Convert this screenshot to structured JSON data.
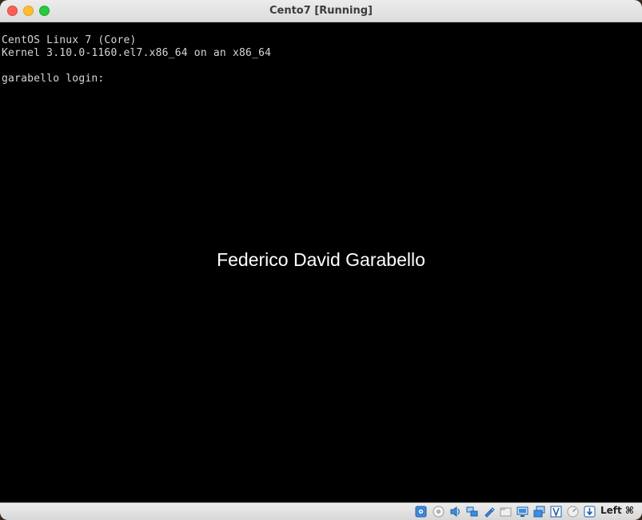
{
  "window": {
    "title": "Cento7 [Running]"
  },
  "console": {
    "lines": [
      "CentOS Linux 7 (Core)",
      "Kernel 3.10.0-1160.el7.x86_64 on an x86_64",
      "",
      "garabello login:"
    ]
  },
  "watermark": {
    "text": "Federico David Garabello"
  },
  "statusbar": {
    "icons": [
      "hard-disk-icon",
      "optical-drive-icon",
      "audio-icon",
      "network-icon",
      "usb-icon",
      "shared-folders-icon",
      "display-icon",
      "recording-icon",
      "cpu-virtualization-icon",
      "mouse-integration-icon",
      "keyboard-icon"
    ],
    "host_key": "Left ⌘"
  },
  "colors": {
    "console_bg": "#000000",
    "console_text": "#d6d6d6",
    "watermark_text": "#ffffff",
    "close": "#fe5f57",
    "minimize": "#febc2e",
    "maximize": "#28c840",
    "status_accent": "#2a7fd6"
  }
}
